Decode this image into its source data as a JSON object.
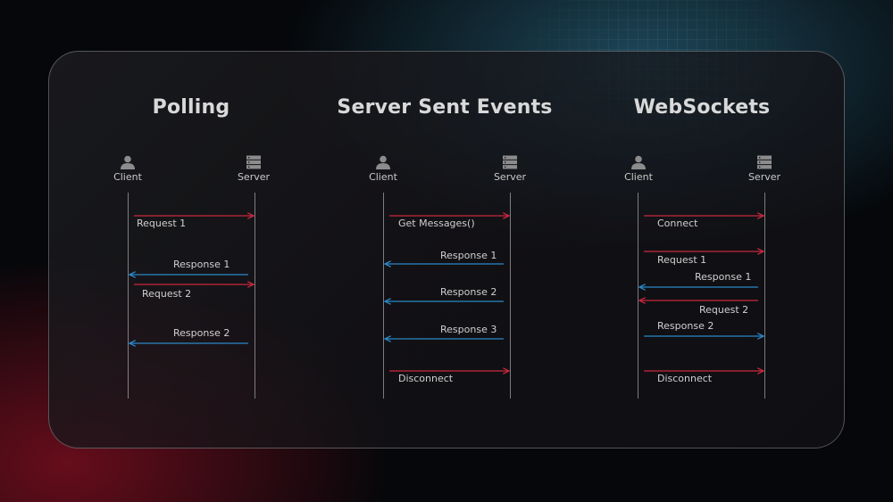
{
  "colors": {
    "request_arrow": "#c9283e",
    "response_arrow": "#2a88c8",
    "text": "#d0d0d0"
  },
  "icons": {
    "client": "user-icon",
    "server": "server-icon"
  },
  "panels": [
    {
      "title": "Polling",
      "client_label": "Client",
      "server_label": "Server",
      "messages": [
        {
          "label": "Request 1",
          "direction": "client-to-server"
        },
        {
          "label": "Response 1",
          "direction": "server-to-client"
        },
        {
          "label": "Request 2",
          "direction": "client-to-server"
        },
        {
          "label": "Response 2",
          "direction": "server-to-client"
        }
      ]
    },
    {
      "title": "Server Sent Events",
      "client_label": "Client",
      "server_label": "Server",
      "messages": [
        {
          "label": "Get Messages()",
          "direction": "client-to-server"
        },
        {
          "label": "Response 1",
          "direction": "server-to-client"
        },
        {
          "label": "Response 2",
          "direction": "server-to-client"
        },
        {
          "label": "Response 3",
          "direction": "server-to-client"
        },
        {
          "label": "Disconnect",
          "direction": "client-to-server"
        }
      ]
    },
    {
      "title": "WebSockets",
      "client_label": "Client",
      "server_label": "Server",
      "messages": [
        {
          "label": "Connect",
          "direction": "client-to-server"
        },
        {
          "label": "Request 1",
          "direction": "client-to-server"
        },
        {
          "label": "Response 1",
          "direction": "server-to-client"
        },
        {
          "label": "Request 2",
          "direction": "server-to-client"
        },
        {
          "label": "Response 2",
          "direction": "client-to-server"
        },
        {
          "label": "Disconnect",
          "direction": "client-to-server"
        }
      ]
    }
  ]
}
